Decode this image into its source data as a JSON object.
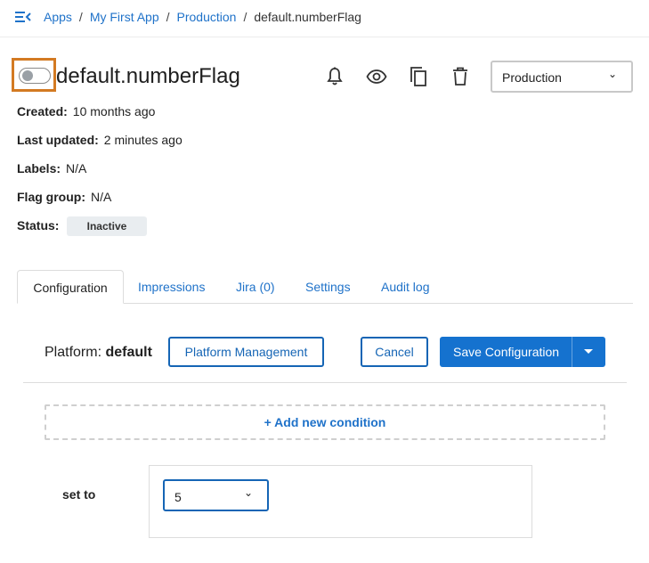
{
  "breadcrumb": {
    "items": [
      "Apps",
      "My First App",
      "Production"
    ],
    "current": "default.numberFlag",
    "separator": "/"
  },
  "header": {
    "title": "default.numberFlag",
    "toggle_on": false,
    "icons": [
      "bell-icon",
      "eye-icon",
      "copy-icon",
      "trash-icon"
    ],
    "environment": "Production"
  },
  "meta": {
    "created_label": "Created:",
    "created_value": "10 months ago",
    "updated_label": "Last updated:",
    "updated_value": "2 minutes ago",
    "labels_label": "Labels:",
    "labels_value": "N/A",
    "group_label": "Flag group:",
    "group_value": "N/A",
    "status_label": "Status:",
    "status_value": "Inactive"
  },
  "tabs": [
    {
      "label": "Configuration",
      "active": true
    },
    {
      "label": "Impressions",
      "active": false
    },
    {
      "label": "Jira (0)",
      "active": false
    },
    {
      "label": "Settings",
      "active": false
    },
    {
      "label": "Audit log",
      "active": false
    }
  ],
  "config": {
    "platform_label": "Platform:",
    "platform_value": "default",
    "platform_management": "Platform Management",
    "cancel": "Cancel",
    "save": "Save Configuration",
    "add_condition": "+ Add new condition",
    "set_to_label": "set to",
    "value": "5"
  },
  "colors": {
    "link": "#1f72c9",
    "primary": "#1572cf",
    "highlight": "#d37a22"
  }
}
